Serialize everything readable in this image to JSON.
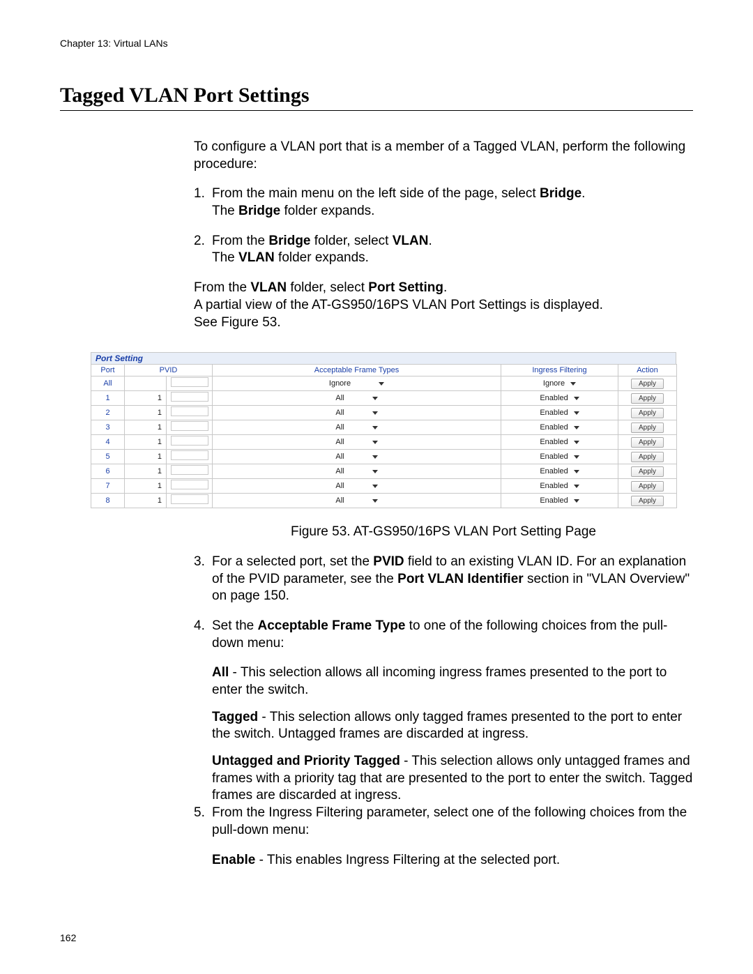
{
  "chapter": "Chapter 13: Virtual LANs",
  "page_number": "162",
  "section_title": "Tagged VLAN Port Settings",
  "intro": "To configure a VLAN port that is a member of a Tagged VLAN, perform the following procedure:",
  "steps": {
    "s1": {
      "num": "1.",
      "line1a": "From the main menu on the left side of the page, select ",
      "bridge": "Bridge",
      "line1b": ".",
      "line2a": "The ",
      "line2b": " folder expands."
    },
    "s2": {
      "num": "2.",
      "line1a": "From the ",
      "bridge": "Bridge",
      "line1b": " folder, select ",
      "vlan": "VLAN",
      "line1c": ".",
      "line2a": "The ",
      "line2b": " folder expands."
    },
    "s2b": {
      "line1a": "From the ",
      "vlan": "VLAN",
      "line1b": " folder, select ",
      "ps": "Port Setting",
      "line1c": ".",
      "line2": "A partial view of the AT-GS950/16PS VLAN Port Settings is displayed.",
      "line3": "See Figure 53."
    },
    "s3": {
      "num": "3.",
      "l1a": "For a selected port, set the ",
      "pvid": "PVID",
      "l1b": " field to an existing VLAN ID. For an explanation of the PVID parameter, see the ",
      "pvi": "Port VLAN Identifier",
      "l1c": " section in \"VLAN Overview\" on page 150."
    },
    "s4": {
      "num": "4.",
      "l1a": "Set the ",
      "aft": "Acceptable Frame Type",
      "l1b": " to one of the following choices from the pull-down menu:",
      "opt_all_b": "All",
      "opt_all_t": " - This selection allows all incoming ingress frames presented to the port to enter the switch.",
      "opt_tag_b": "Tagged",
      "opt_tag_t": " - This selection allows only tagged frames presented to the port to enter the switch. Untagged frames are discarded at ingress.",
      "opt_upt_b": "Untagged and Priority Tagged",
      "opt_upt_t": " - This selection allows only untagged frames and frames with a priority tag that are presented to the port to enter the switch. Tagged frames are discarded at ingress."
    },
    "s5": {
      "num": "5.",
      "l1": "From the Ingress Filtering parameter, select one of the following choices from the pull-down menu:",
      "opt_en_b": "Enable",
      "opt_en_t": " - This enables Ingress Filtering at the selected port."
    }
  },
  "figure": {
    "panel_title": "Port Setting",
    "caption": "Figure 53. AT-GS950/16PS VLAN Port Setting Page",
    "headers": {
      "port": "Port",
      "pvid": "PVID",
      "aft": "Acceptable Frame Types",
      "if": "Ingress Filtering",
      "action": "Action"
    },
    "action_label": "Apply",
    "rows": [
      {
        "port": "All",
        "pvid": "",
        "aft": "Ignore",
        "if": "Ignore"
      },
      {
        "port": "1",
        "pvid": "1",
        "aft": "All",
        "if": "Enabled"
      },
      {
        "port": "2",
        "pvid": "1",
        "aft": "All",
        "if": "Enabled"
      },
      {
        "port": "3",
        "pvid": "1",
        "aft": "All",
        "if": "Enabled"
      },
      {
        "port": "4",
        "pvid": "1",
        "aft": "All",
        "if": "Enabled"
      },
      {
        "port": "5",
        "pvid": "1",
        "aft": "All",
        "if": "Enabled"
      },
      {
        "port": "6",
        "pvid": "1",
        "aft": "All",
        "if": "Enabled"
      },
      {
        "port": "7",
        "pvid": "1",
        "aft": "All",
        "if": "Enabled"
      },
      {
        "port": "8",
        "pvid": "1",
        "aft": "All",
        "if": "Enabled"
      }
    ]
  }
}
